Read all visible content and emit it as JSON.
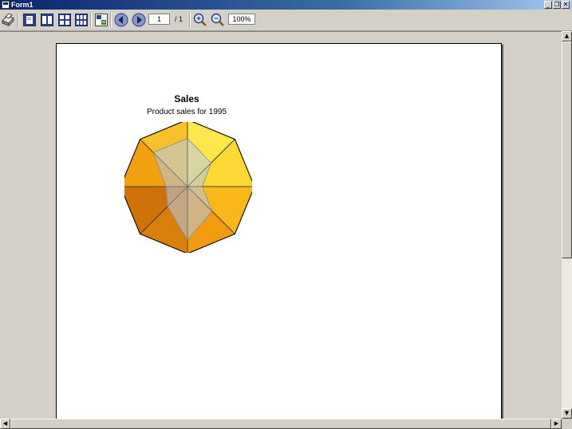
{
  "window": {
    "title": "Form1"
  },
  "toolbar": {
    "page_current": "1",
    "page_total": "/ 1",
    "zoom": "100%"
  },
  "chart_data": {
    "type": "radar",
    "title": "Sales",
    "subtitle": "Product sales for 1995",
    "axes_count": 8,
    "outer_values": [
      1,
      1,
      1,
      1,
      1,
      1,
      1,
      1
    ],
    "inner_values": [
      0.72,
      0.5,
      0.22,
      0.52,
      0.8,
      0.42,
      0.32,
      0.72
    ],
    "outer_fill_colors": [
      "#fde74c",
      "#fdd835",
      "#f9b71a",
      "#f29b10",
      "#d97f0a",
      "#d07208",
      "#f0a010",
      "#f8c02a"
    ],
    "inner_fill": "#b4c8e8"
  }
}
